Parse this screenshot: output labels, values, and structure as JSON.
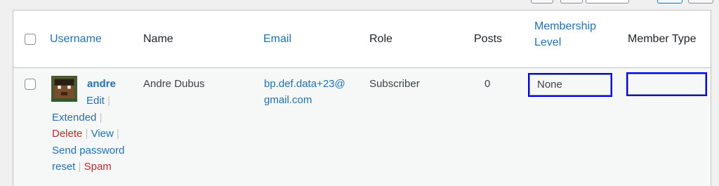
{
  "table": {
    "columns": {
      "username": "Username",
      "name": "Name",
      "email": "Email",
      "role": "Role",
      "posts": "Posts",
      "membership_level_line1": "Membership",
      "membership_level_line2": "Level",
      "member_type": "Member Type"
    },
    "rows": [
      {
        "username": "andre",
        "actions": {
          "edit": "Edit",
          "extended": "Extended",
          "delete": "Delete",
          "view": "View",
          "send_password_reset_1": "Send password",
          "send_password_reset_2": "reset",
          "spam": "Spam",
          "separator": "|"
        },
        "name": "Andre Dubus",
        "email_line1": "bp.def.data+23@",
        "email_line2": "gmail.com",
        "role": "Subscriber",
        "posts": "0",
        "membership_level": "None",
        "member_type": ""
      }
    ]
  },
  "colors": {
    "link": "#2271b1",
    "destructive": "#b32d2e",
    "focus_outline": "#0000ee"
  }
}
